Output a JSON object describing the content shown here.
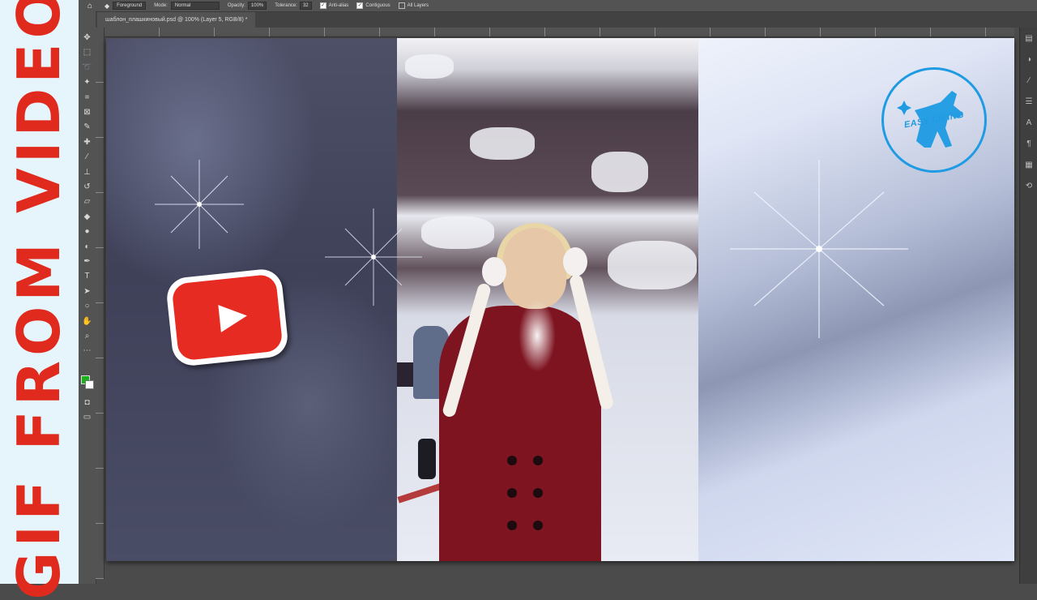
{
  "banner": {
    "title": "GIF FROM VIDEO",
    "color": "#e12a1e",
    "background": "#e6f4fb"
  },
  "options_bar": {
    "sample_label": "Foreground",
    "mode_label": "Mode:",
    "mode_value": "Normal",
    "opacity_label": "Opacity:",
    "opacity_value": "100%",
    "tolerance_label": "Tolerance:",
    "tolerance_value": "32",
    "checkboxes": [
      {
        "label": "Anti-alias",
        "checked": true
      },
      {
        "label": "Contiguous",
        "checked": true
      },
      {
        "label": "All Layers",
        "checked": false
      }
    ]
  },
  "document": {
    "tab_title": "шаблон_плашкиновый.psd @ 100% (Layer 5, RGB/8) *"
  },
  "tools": [
    {
      "name": "move-tool-icon",
      "glyph": "✥"
    },
    {
      "name": "marquee-tool-icon",
      "glyph": "⬚"
    },
    {
      "name": "lasso-tool-icon",
      "glyph": "➰"
    },
    {
      "name": "magic-wand-tool-icon",
      "glyph": "✦"
    },
    {
      "name": "crop-tool-icon",
      "glyph": "⌗"
    },
    {
      "name": "frame-tool-icon",
      "glyph": "⊠"
    },
    {
      "name": "eyedropper-tool-icon",
      "glyph": "✎"
    },
    {
      "name": "healing-brush-tool-icon",
      "glyph": "✚"
    },
    {
      "name": "brush-tool-icon",
      "glyph": "∕"
    },
    {
      "name": "clone-stamp-tool-icon",
      "glyph": "⊥"
    },
    {
      "name": "history-brush-tool-icon",
      "glyph": "↺"
    },
    {
      "name": "eraser-tool-icon",
      "glyph": "▱"
    },
    {
      "name": "paint-bucket-tool-icon",
      "glyph": "◆"
    },
    {
      "name": "blur-tool-icon",
      "glyph": "●"
    },
    {
      "name": "dodge-tool-icon",
      "glyph": "◐"
    },
    {
      "name": "pen-tool-icon",
      "glyph": "✒"
    },
    {
      "name": "type-tool-icon",
      "glyph": "T"
    },
    {
      "name": "path-selection-tool-icon",
      "glyph": "➤"
    },
    {
      "name": "ellipse-tool-icon",
      "glyph": "○"
    },
    {
      "name": "hand-tool-icon",
      "glyph": "✋"
    },
    {
      "name": "zoom-tool-icon",
      "glyph": "⌕"
    },
    {
      "name": "more-tools-icon",
      "glyph": "⋯"
    }
  ],
  "swatches": {
    "foreground": "#19b319",
    "background": "#ffffff"
  },
  "right_panel_icons": [
    "layers-panel-icon",
    "adjustments-panel-icon",
    "brush-panel-icon",
    "properties-panel-icon",
    "character-panel-icon",
    "paragraph-panel-icon"
  ],
  "canvas": {
    "youtube_logo": {
      "name": "youtube-logo",
      "color": "#e52b22"
    },
    "brand_logo": {
      "text": "EASY LIVING",
      "color": "#1e9be3"
    }
  }
}
